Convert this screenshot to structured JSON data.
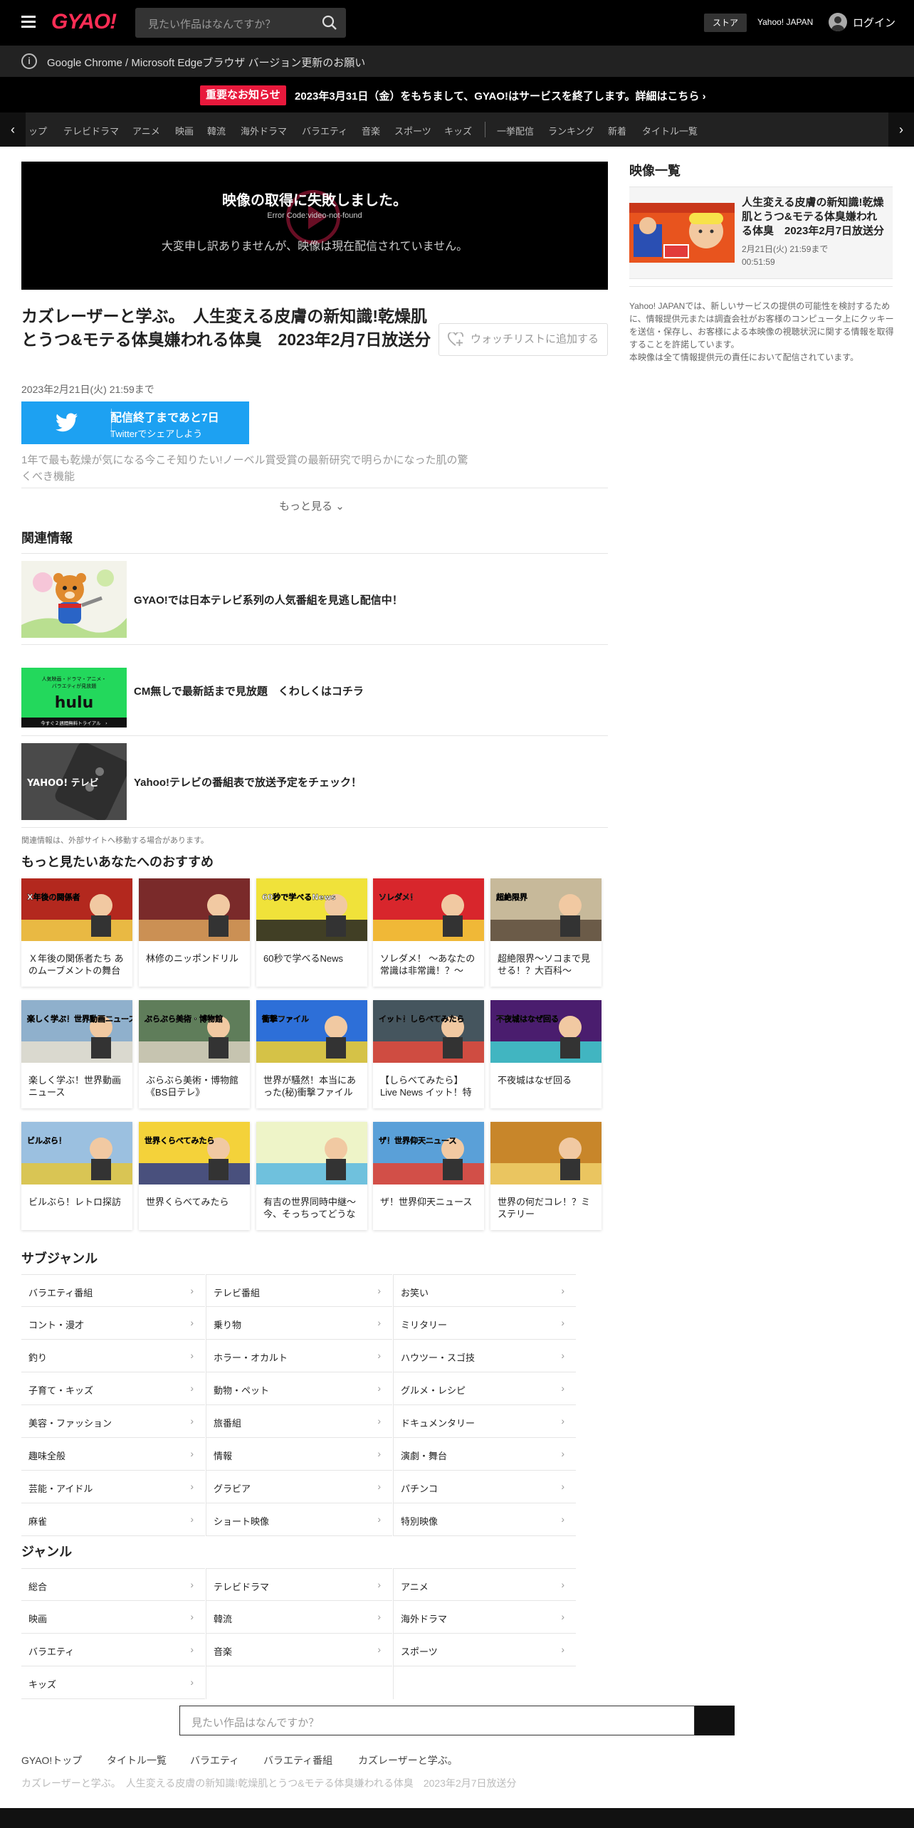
{
  "header": {
    "logo": "GYAO!",
    "search_placeholder": "見たい作品はなんですか？",
    "store": "ストア",
    "yahoo_japan": "Yahoo! JAPAN",
    "login": "ログイン"
  },
  "browser_notice": "Google Chrome / Microsoft Edgeブラウザ バージョン更新のお願い",
  "important": {
    "badge": "重要なお知らせ",
    "text": "2023年3月31日（金）をもちまして、GYAO!はサービスを終了します。詳細はこちら"
  },
  "gnav": [
    "ップ",
    "テレビドラマ",
    "アニメ",
    "映画",
    "韓流",
    "海外ドラマ",
    "バラエティ",
    "音楽",
    "スポーツ",
    "キッズ",
    "一挙配信",
    "ランキング",
    "新着",
    "タイトル一覧"
  ],
  "player": {
    "title": "映像の取得に失敗しました。",
    "code": "Error Code:video-not-found",
    "message": "大変申し訳ありませんが、映像は現在配信されていません。"
  },
  "video": {
    "title": "カズレーザーと学ぶ。　人生変える皮膚の新知識!乾燥肌とうつ&モテる体臭嫌われる体臭　2023年2月7日放送分",
    "watchlist": "ウォッチリストに追加する",
    "air_until": "2023年2月21日(火) 21:59まで",
    "twitter_main": "配信終了まであと7日",
    "twitter_sub": "Twitterでシェアしよう",
    "description": "1年で最も乾燥が気になる今こそ知りたい!ノーベル賞受賞の最新研究で明らかになった肌の驚くべき機能",
    "more": "もっと見る"
  },
  "related": {
    "heading": "関連情報",
    "items": [
      "GYAO!では日本テレビ系列の人気番組を見逃し配信中！",
      "CM無しで最新話まで見放題　くわしくはコチラ",
      "Yahoo!テレビの番組表で放送予定をチェック！"
    ],
    "hulu_banner": [
      "人気映画・ドラマ・アニメ・",
      "バラエティが見放題",
      "hulu",
      "今すぐ２週間無料トライアル　›"
    ],
    "yahoo_tv_logo": "YAHOO! テレビ",
    "note": "関連情報は、外部サイトへ移動する場合があります。"
  },
  "recommend": {
    "heading": "もっと見たいあなたへのおすすめ",
    "cards": [
      "Ｘ年後の関係者たち あのムーブメントの舞台",
      "林修のニッポンドリル",
      "60秒で学べるNews",
      "ソレダメ！ ～あなたの常識は非常識！？～",
      "超絶限界～ソコまで見せる！？大百科～",
      "楽しく学ぶ！世界動画ニュース",
      "ぶらぶら美術・博物館《BS日テレ》",
      "世界が騒然！本当にあった(秘)衝撃ファイル",
      "【しらべてみたら】Live News イット！特集",
      "不夜城はなぜ回る",
      "ビルぶら！レトロ探訪",
      "世界くらべてみたら",
      "有吉の世界同時中継～今、そっちってどうなってますか？～",
      "ザ！世界仰天ニュース",
      "世界の何だコレ！？ミステリー"
    ],
    "thumb_text": [
      "X年後の関係者",
      "",
      "60秒で学べるNews",
      "ソレダメ！",
      "超絶限界",
      "楽しく学ぶ！世界動画ニュース",
      "ぶらぶら美術・博物館",
      "衝撃ファイル",
      "イット！しらべてみたら",
      "不夜城はなぜ回る",
      "ビルぶら！",
      "世界くらべてみたら",
      "",
      "ザ！世界仰天ニュース",
      ""
    ]
  },
  "subgenre": {
    "heading": "サブジャンル",
    "items": [
      "バラエティ番組",
      "テレビ番組",
      "お笑い",
      "コント・漫才",
      "乗り物",
      "ミリタリー",
      "釣り",
      "ホラー・オカルト",
      "ハウツー・スゴ技",
      "子育て・キッズ",
      "動物・ペット",
      "グルメ・レシピ",
      "美容・ファッション",
      "旅番組",
      "ドキュメンタリー",
      "趣味全般",
      "情報",
      "演劇・舞台",
      "芸能・アイドル",
      "グラビア",
      "パチンコ",
      "麻雀",
      "ショート映像",
      "特別映像"
    ]
  },
  "genre": {
    "heading": "ジャンル",
    "items": [
      "総合",
      "テレビドラマ",
      "アニメ",
      "映画",
      "韓流",
      "海外ドラマ",
      "バラエティ",
      "音楽",
      "スポーツ",
      "キッズ"
    ]
  },
  "bottom_search_placeholder": "見たい作品はなんですか？",
  "breadcrumb": [
    "GYAO!トップ",
    "タイトル一覧",
    "バラエティ",
    "バラエティ番組",
    "カズレーザーと学ぶ。"
  ],
  "footer_title": "カズレーザーと学ぶ。　人生変える皮膚の新知識!乾燥肌とうつ&モテる体臭嫌われる体臭　2023年2月7日放送分",
  "sidebar": {
    "heading": "映像一覧",
    "item_title": "人生変える皮膚の新知識!乾燥肌とうつ&モテる体臭嫌われる体臭　2023年2月7日放送分",
    "item_date": "2月21日(火) 21:59まで",
    "item_duration": "00:51:59",
    "notice": "Yahoo! JAPANでは、新しいサービスの提供の可能性を検討するために、情報提供元または調査会社がお客様のコンピュータ上にクッキーを送信・保存し、お客様による本映像の視聴状況に関する情報を取得することを許諾しています。\n本映像は全て情報提供元の責任において配信されています。"
  },
  "colors": {
    "brand": "#ff2d55",
    "important_badge": "#e8193c",
    "twitter": "#1da1f2"
  }
}
